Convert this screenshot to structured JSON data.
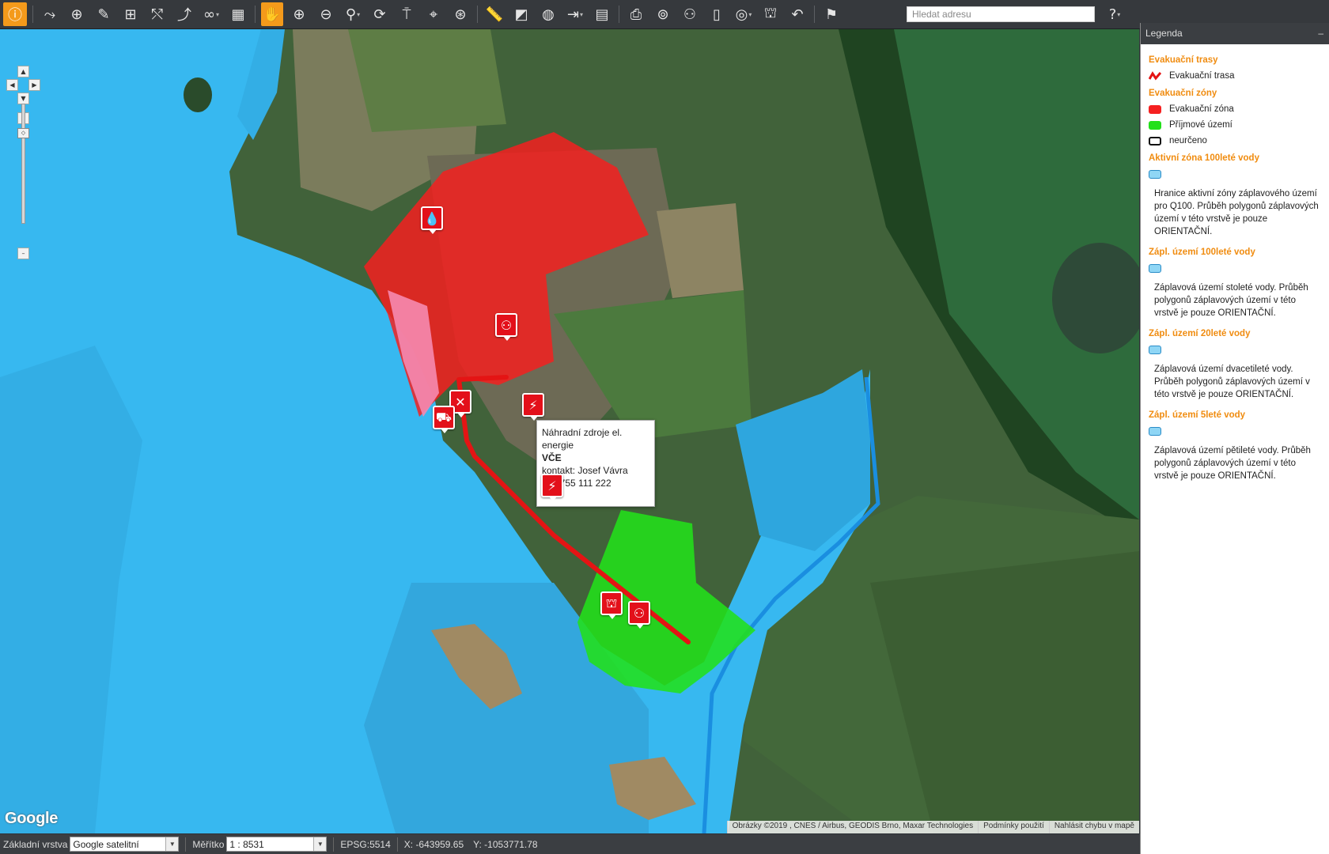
{
  "toolbar": {
    "tools": [
      {
        "name": "info-icon",
        "glyph": "ⓘ"
      },
      {
        "name": "route-icon",
        "glyph": "⤳"
      },
      {
        "name": "add-place-icon",
        "glyph": "⊕"
      },
      {
        "name": "draw-line-icon",
        "glyph": "✎"
      },
      {
        "name": "add-shape-icon",
        "glyph": "⊞"
      },
      {
        "name": "measure-route-icon",
        "glyph": "⤲"
      },
      {
        "name": "evacuation-tool-icon",
        "glyph": "⤴"
      },
      {
        "name": "binoculars-icon",
        "glyph": "∞"
      },
      {
        "name": "calculator-icon",
        "glyph": "▦"
      },
      {
        "name": "pan-hand-icon",
        "glyph": "✋"
      },
      {
        "name": "zoom-in-icon",
        "glyph": "⊕"
      },
      {
        "name": "zoom-out-icon",
        "glyph": "⊖"
      },
      {
        "name": "zoom-select-icon",
        "glyph": "⚲"
      },
      {
        "name": "refresh-icon",
        "glyph": "⟳"
      },
      {
        "name": "person-pin-icon",
        "glyph": "⍑"
      },
      {
        "name": "location-pin-icon",
        "glyph": "⌖"
      },
      {
        "name": "crosshair-icon",
        "glyph": "⊛"
      },
      {
        "name": "ruler-icon",
        "glyph": "📏"
      },
      {
        "name": "area-icon",
        "glyph": "◩"
      },
      {
        "name": "globe-icon",
        "glyph": "◍"
      },
      {
        "name": "export-icon",
        "glyph": "⇥"
      },
      {
        "name": "document-icon",
        "glyph": "▤"
      },
      {
        "name": "print-icon",
        "glyph": "⎙"
      },
      {
        "name": "web-layer-icon",
        "glyph": "⊚"
      },
      {
        "name": "people-icon",
        "glyph": "⚇"
      },
      {
        "name": "clipboard-icon",
        "glyph": "▯"
      },
      {
        "name": "coins-icon",
        "glyph": "◎"
      },
      {
        "name": "bed-icon",
        "glyph": "⛫"
      },
      {
        "name": "back-icon",
        "glyph": "↶"
      },
      {
        "name": "bookmark-icon",
        "glyph": "⚑"
      }
    ],
    "search_placeholder": "Hledat adresu",
    "help_glyph": "?"
  },
  "map": {
    "popup": {
      "title": "Náhradní zdroje el. energie",
      "name": "VČE",
      "contact": "kontakt: Josef Vávra",
      "phone": "tel.: 755 111 222"
    },
    "google_logo": "Google",
    "attribution": {
      "imagery": "Obrázky ©2019 , CNES / Airbus, GEODIS Brno, Maxar Technologies",
      "terms": "Podmínky použití",
      "report": "Nahlásit chybu v mapě"
    },
    "colors": {
      "flood": "#37b8f0",
      "evac_zone": "#f52020",
      "reception_zone": "#22e01a",
      "route": "#e41414"
    }
  },
  "legend": {
    "title": "Legenda",
    "minimize": "–",
    "sections": [
      {
        "heading": "Evakuační trasy",
        "items": [
          {
            "label": "Evakuační trasa",
            "swatch": "route"
          }
        ]
      },
      {
        "heading": "Evakuační zóny",
        "items": [
          {
            "label": "Evakuační zóna",
            "swatch": "red"
          },
          {
            "label": "Příjmové území",
            "swatch": "green"
          },
          {
            "label": "neurčeno",
            "swatch": "outline"
          }
        ]
      },
      {
        "heading": "Aktivní zóna 100leté vody",
        "desc": "Hranice aktivní zóny záplavového území pro Q100. Průběh polygonů záplavových území v této vrstvě je pouze ORIENTAČNÍ."
      },
      {
        "heading": "Zápl. území 100leté vody",
        "desc": "Záplavová území stoleté vody. Průběh polygonů záplavových území v této vrstvě je pouze ORIENTAČNÍ."
      },
      {
        "heading": "Zápl. území 20leté vody",
        "desc": "Záplavová území dvacetileté vody. Průběh polygonů záplavových území v této vrstvě je pouze ORIENTAČNÍ."
      },
      {
        "heading": "Zápl. území 5leté vody",
        "desc": "Záplavová území pětileté vody. Průběh polygonů záplavových území v této vrstvě je pouze ORIENTAČNÍ."
      }
    ]
  },
  "status": {
    "base_layer_label": "Základní vrstva",
    "base_layer_value": "Google satelitní",
    "scale_label": "Měřítko",
    "scale_value": "1 : 8531",
    "epsg": "EPSG:5514",
    "x": "X: -643959.65",
    "y": "Y: -1053771.78"
  }
}
